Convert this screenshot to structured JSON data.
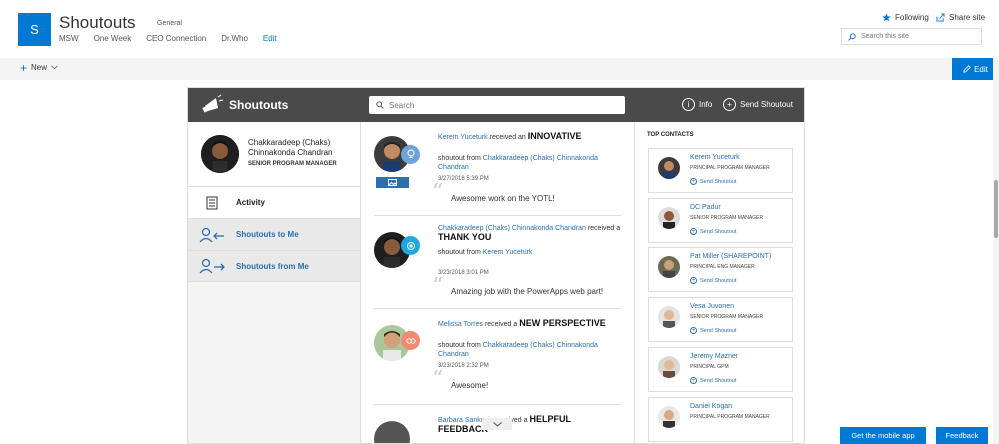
{
  "site": {
    "logo_letter": "S",
    "title": "Shoutouts",
    "subtitle": "General",
    "nav": [
      "MSW",
      "One Week",
      "CEO Connection",
      "Dr.Who",
      "Edit"
    ],
    "following_label": "Following",
    "share_label": "Share site",
    "search_placeholder": "Search this site",
    "new_label": "New",
    "edit_label": "Edit"
  },
  "app": {
    "title": "Shoutouts",
    "search_placeholder": "Search",
    "info_label": "Info",
    "send_label": "Send Shoutout"
  },
  "profile": {
    "name": "Chakkaradeep (Chaks) Chinnakonda Chandran",
    "role": "SENIOR PROGRAM MANAGER"
  },
  "nav": {
    "activity": "Activity",
    "to_me": "Shoutouts to Me",
    "from_me": "Shoutouts from Me"
  },
  "feed": [
    {
      "recipient": "Kerem Yuceturk",
      "verb": "received an",
      "award": "INNOVATIVE",
      "from_prefix": "shoutout from",
      "sender": "Chakkaradeep (Chaks) Chinnakonda Chandran",
      "date": "3/27/2018 5:39 PM",
      "message": "Awesome work on the YOTL!"
    },
    {
      "recipient": "Chakkaradeep (Chaks) Chinnakonda Chandran",
      "verb": "received a",
      "award": "THANK YOU",
      "from_prefix": "shoutout from",
      "sender": "Kerem Yuceturk",
      "date": "3/23/2018 3:01 PM",
      "message": "Amazing job with the PowerApps web part!"
    },
    {
      "recipient": "Melissa Torres",
      "verb": "received a",
      "award": "NEW PERSPECTIVE",
      "from_prefix": "shoutout from",
      "sender": "Chakkaradeep (Chaks) Chinnakonda Chandran",
      "date": "3/23/2018 2:32 PM",
      "message": "Awesome!"
    },
    {
      "recipient": "Barbara Sankovic",
      "verb": "received a",
      "award": "HELPFUL FEEDBACK"
    }
  ],
  "contacts": {
    "title": "TOP CONTACTS",
    "send_label": "Send Shoutout",
    "items": [
      {
        "name": "Kerem Yuceturk",
        "role": "PRINCIPAL PROGRAM MANAGER"
      },
      {
        "name": "DC Padur",
        "role": "SENIOR PROGRAM MANAGER"
      },
      {
        "name": "Pat Miller (SHAREPOINT)",
        "role": "PRINCIPAL ENG MANAGER"
      },
      {
        "name": "Vesa Juvonen",
        "role": "SENIOR PROGRAM MANAGER"
      },
      {
        "name": "Jeremy Mazner",
        "role": "PRINCIPAL GPM"
      },
      {
        "name": "Daniel Kogan",
        "role": "PRINCIPAL PROGRAM MANAGER"
      }
    ]
  },
  "footer": {
    "mobile_label": "Get the mobile app",
    "feedback_label": "Feedback"
  },
  "colors": {
    "accent": "#0078d4",
    "link": "#2b6fb1",
    "app_header": "#4a4a4a"
  }
}
